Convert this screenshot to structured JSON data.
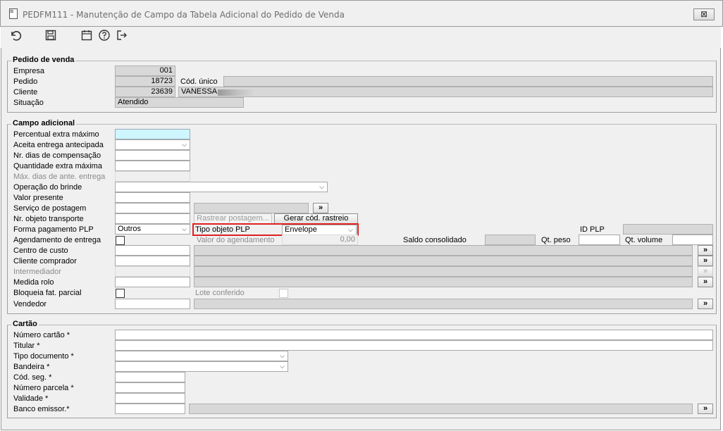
{
  "window": {
    "title": "PEDFM111 - Manutenção de Campo da Tabela Adicional do Pedido de Venda",
    "close_label": "⊠"
  },
  "toolbar": {
    "icons": [
      "undo-icon",
      "save-icon",
      "calendar-icon",
      "help-icon",
      "exit-icon"
    ]
  },
  "pedido": {
    "title": "Pedido de venda",
    "empresa_label": "Empresa",
    "empresa_value": "001",
    "pedido_label": "Pedido",
    "pedido_value": "18723",
    "cod_unico_label": "Cód. único",
    "cod_unico_value": "",
    "cliente_label": "Cliente",
    "cliente_code": "23639",
    "cliente_name": "VANESSA",
    "situacao_label": "Situação",
    "situacao_value": "Atendido"
  },
  "campo": {
    "title": "Campo adicional",
    "percentual_label": "Percentual extra máximo",
    "aceita_label": "Aceita entrega antecipada",
    "nr_dias_label": "Nr. dias de compensação",
    "qtd_extra_label": "Quantidade extra máxima",
    "max_dias_label": "Máx. dias de ante. entrega",
    "operacao_label": "Operação do brinde",
    "valor_presente_label": "Valor presente",
    "servico_label": "Serviço de postagem",
    "nr_objeto_label": "Nr. objeto transporte",
    "rastrear_label": "Rastrear postagem...",
    "gerar_label": "Gerar cód. rastreio",
    "forma_pag_label": "Forma pagamento PLP",
    "forma_pag_value": "Outros",
    "tipo_objeto_label": "Tipo objeto PLP",
    "tipo_objeto_value": "Envelope",
    "id_plp_label": "ID PLP",
    "agendamento_label": "Agendamento de entrega",
    "valor_agend_label": "Valor do agendamento",
    "valor_agend_value": "0,00",
    "saldo_label": "Saldo consolidado",
    "qt_peso_label": "Qt. peso",
    "qt_volume_label": "Qt. volume",
    "centro_label": "Centro de custo",
    "cliente_comp_label": "Cliente comprador",
    "intermediador_label": "Intermediador",
    "medida_label": "Medida rolo",
    "bloqueia_label": "Bloqueia fat. parcial",
    "lote_label": "Lote conferido",
    "vendedor_label": "Vendedor"
  },
  "cartao": {
    "title": "Cartão",
    "numero_label": "Número cartão *",
    "titular_label": "Titular *",
    "tipo_doc_label": "Tipo documento *",
    "bandeira_label": "Bandeira *",
    "cod_seg_label": "Cód. seg. *",
    "num_parcela_label": "Número parcela *",
    "validade_label": "Validade *",
    "banco_label": "Banco emissor.*"
  },
  "glyphs": {
    "lookup": "»",
    "dropdown": "⌵"
  }
}
